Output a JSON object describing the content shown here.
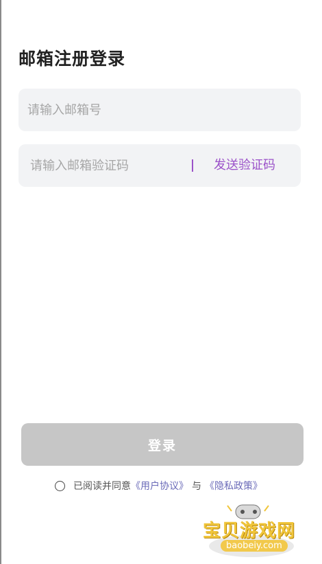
{
  "page": {
    "title": "邮箱注册登录"
  },
  "form": {
    "email_placeholder": "请输入邮箱号",
    "code_placeholder": "请输入邮箱验证码",
    "send_code_label": "发送验证码"
  },
  "login_button_label": "登录",
  "agreement": {
    "prefix": "已阅读并同意",
    "user_agreement": "《用户协议》",
    "and": "与",
    "privacy_policy": "《隐私政策》"
  },
  "watermark": {
    "name": "宝贝游戏网",
    "url": "baobeiy.com"
  },
  "colors": {
    "accent": "#9b52c9",
    "link": "#6a6ab8",
    "button_disabled": "#c6c6c6",
    "field_bg": "#f2f3f5"
  }
}
